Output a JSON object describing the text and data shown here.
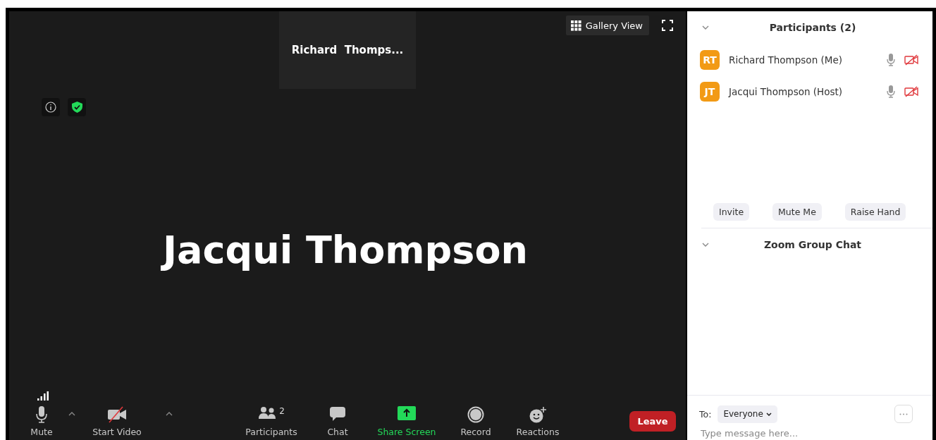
{
  "thumbnail": {
    "name": "Richard  Thomps..."
  },
  "view_button": {
    "label": "Gallery View"
  },
  "speaker": {
    "name": "Jacqui Thompson"
  },
  "toolbar": [
    {
      "kind": "mute",
      "label": "Mute",
      "caret": true
    },
    {
      "kind": "video",
      "label": "Start Video",
      "caret": true
    },
    {
      "kind": "participants",
      "label": "Participants",
      "count": "2",
      "caret": false
    },
    {
      "kind": "chat",
      "label": "Chat",
      "caret": false
    },
    {
      "kind": "share",
      "label": "Share Screen",
      "caret": false
    },
    {
      "kind": "record",
      "label": "Record",
      "caret": false
    },
    {
      "kind": "reactions",
      "label": "Reactions",
      "caret": false
    }
  ],
  "leave_button": {
    "label": "Leave"
  },
  "participants_panel": {
    "title": "Participants (2)",
    "expanded": true,
    "participants": [
      {
        "initials": "RT",
        "name": "Richard Thompson (Me)",
        "video_off": true
      },
      {
        "initials": "JT",
        "name": "Jacqui Thompson (Host)",
        "video_off": true
      }
    ],
    "buttons": [
      "Invite",
      "Mute Me",
      "Raise Hand"
    ]
  },
  "chat_panel": {
    "title": "Zoom Group Chat",
    "expanded": true,
    "to_label": "To:",
    "recipient": "Everyone",
    "placeholder": "Type message here..."
  }
}
